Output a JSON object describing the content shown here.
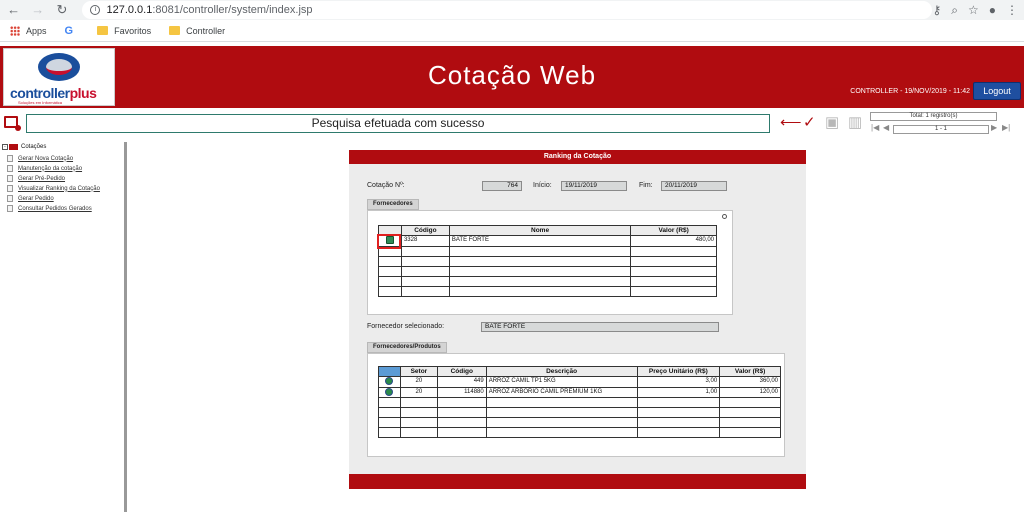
{
  "browser": {
    "url_host": "127.0.0.1",
    "url_path": ":8081/controller/system/index.jsp",
    "bookmarks": [
      "Apps",
      "Favoritos",
      "Controller"
    ]
  },
  "header": {
    "logo_text_a": "controller",
    "logo_text_b": "plus",
    "logo_sub": "Soluções em Informática",
    "title": "Cotação Web",
    "user_info": "CONTROLLER - 19/NOV/2019 - 11:42",
    "logout_label": "Logout",
    "brand_color": "#b00c10"
  },
  "toolbar": {
    "message": "Pesquisa efetuada com sucesso",
    "total": "Total: 1 registro(s)",
    "page": "1 - 1"
  },
  "sidebar": {
    "root": "Cotações",
    "items": [
      "Gerar Nova Cotação",
      "Manutenção da cotação",
      "Gerar Pré-Pedido",
      "Visualizar Ranking da Cotação",
      "Gerar Pedido",
      "Consultar Pedidos Gerados"
    ]
  },
  "panel": {
    "title": "Ranking da Cotação",
    "cotacao_label": "Cotação Nº:",
    "cotacao_value": "764",
    "inicio_label": "Início:",
    "inicio_value": "19/11/2019",
    "fim_label": "Fim:",
    "fim_value": "20/11/2019",
    "fornecedores_tab": "Fornecedores",
    "fornecedores_table": {
      "headers": [
        "Código",
        "Nome",
        "Valor (R$)"
      ],
      "rows": [
        [
          "3328",
          "BATE FORTE",
          "480,00"
        ]
      ]
    },
    "selected_label": "Fornecedor selecionado:",
    "selected_value": "BATE FORTE",
    "produtos_tab": "Fornecedores/Produtos",
    "produtos_table": {
      "headers": [
        "Setor",
        "Código",
        "Descrição",
        "Preço Unitário (R$)",
        "Valor (R$)"
      ],
      "rows": [
        [
          "20",
          "449",
          "ARROZ CAMIL TP1 5KG",
          "3,00",
          "360,00"
        ],
        [
          "20",
          "114880",
          "ARROZ ARBORIO CAMIL PREMIUM  1KG",
          "1,00",
          "120,00"
        ]
      ]
    }
  }
}
